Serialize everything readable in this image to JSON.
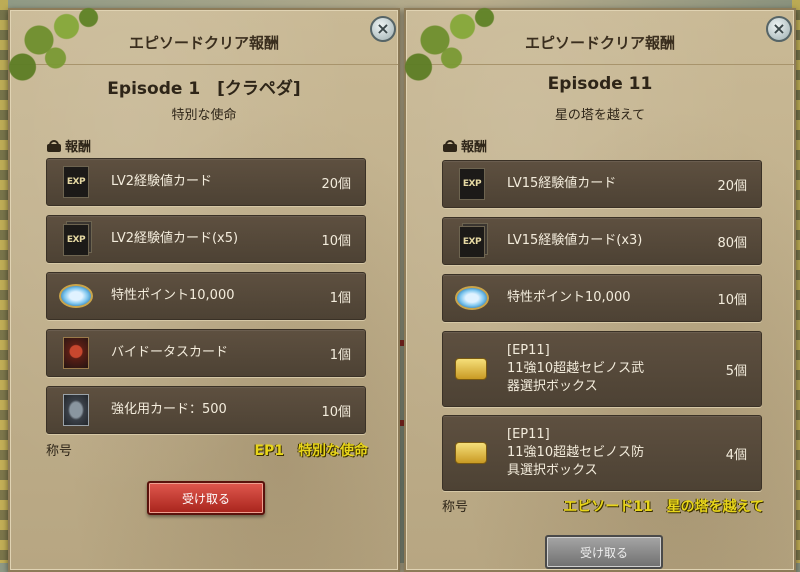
{
  "panels": [
    {
      "header": "エピソードクリア報酬",
      "close_symbol": "×",
      "episode_title": "Episode 1　[クラペダ]",
      "episode_subtitle": "特別な使命",
      "reward_label": "報酬",
      "items": [
        {
          "icon": "exp-card-icon",
          "icon_text": "EXP",
          "name": "LV2経験値カード",
          "count": "20個"
        },
        {
          "icon": "exp-card-stack-icon",
          "icon_text": "EXP",
          "name": "LV2経験値カード(x5)",
          "count": "10個"
        },
        {
          "icon": "trait-point-icon",
          "name": "特性ポイント10,000",
          "count": "1個"
        },
        {
          "icon": "bydo-card-icon",
          "name": "バイドータスカード",
          "count": "1個"
        },
        {
          "icon": "enhance-card-icon",
          "name": "強化用カード：500",
          "count": "10個"
        }
      ],
      "title_label": "称号",
      "title_value": "EP1　特別な使命",
      "button": {
        "label": "受け取る",
        "state": "active"
      }
    },
    {
      "header": "エピソードクリア報酬",
      "close_symbol": "×",
      "episode_title": "Episode 11",
      "episode_subtitle": "星の塔を越えて",
      "reward_label": "報酬",
      "items": [
        {
          "icon": "exp-card-icon",
          "icon_text": "EXP",
          "name": "LV15経験値カード",
          "count": "20個"
        },
        {
          "icon": "exp-card-stack-icon",
          "icon_text": "EXP",
          "name": "LV15経験値カード(x3)",
          "count": "80個"
        },
        {
          "icon": "trait-point-icon",
          "name": "特性ポイント10,000",
          "count": "10個"
        },
        {
          "icon": "gold-box-icon",
          "name_lines": [
            "[EP11]",
            "11強10超越セビノス武",
            "器選択ボックス"
          ],
          "count": "5個"
        },
        {
          "icon": "gold-box-icon",
          "name_lines": [
            "[EP11]",
            "11強10超越セビノス防",
            "具選択ボックス"
          ],
          "count": "4個"
        }
      ],
      "title_label": "称号",
      "title_value": "エピソード11　星の塔を越えて",
      "button": {
        "label": "受け取る",
        "state": "disabled"
      }
    }
  ],
  "colors": {
    "title_yellow": "#e8d51a",
    "item_bg": "#4d4234",
    "panel_bg": "#c3b391",
    "button_red": "#c0392b",
    "button_gray": "#8a8a8a"
  }
}
